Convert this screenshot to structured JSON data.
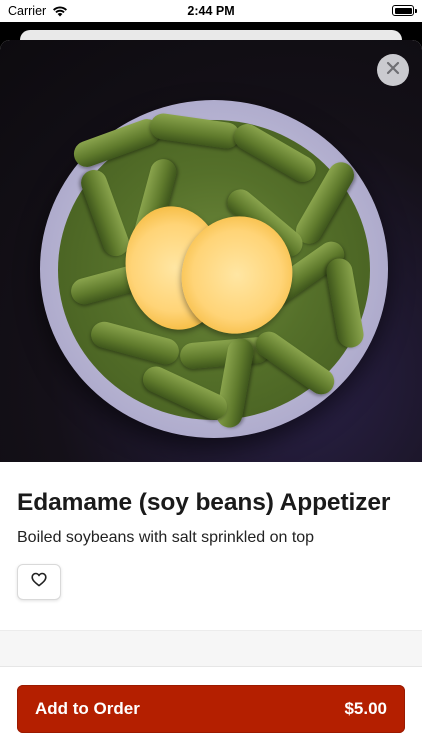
{
  "status_bar": {
    "carrier": "Carrier",
    "time": "2:44 PM"
  },
  "item": {
    "title": "Edamame (soy beans) Appetizer",
    "description": "Boiled soybeans with salt sprinkled on top",
    "image_subject": "bowl of edamame with lemon slices"
  },
  "favorite": {
    "icon": "heart-outline-icon"
  },
  "close": {
    "icon": "close-icon"
  },
  "order_button": {
    "label": "Add to Order",
    "price": "$5.00",
    "color": "#b41f00"
  }
}
